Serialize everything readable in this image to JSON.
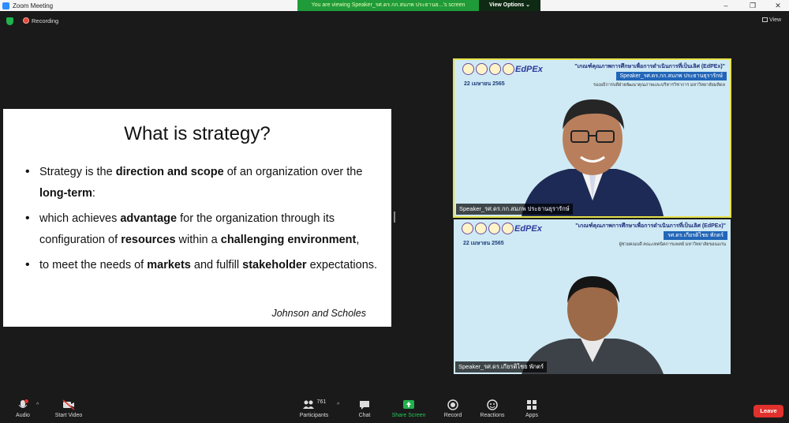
{
  "window": {
    "title": "Zoom Meeting",
    "minimize": "–",
    "restore": "❐",
    "close": "✕"
  },
  "share_banner": {
    "text": "You are viewing Speaker_รศ.ดร.กก.สมภพ ประธานธ...'s screen",
    "view_options": "View Options ⌄"
  },
  "topbar": {
    "recording_label": "Recording",
    "view_label": "View"
  },
  "slide": {
    "title": "What is strategy?",
    "bullets": [
      [
        "Strategy is the ",
        "direction and scope",
        " of an organization over the ",
        "long-term",
        ":"
      ],
      [
        "which achieves ",
        "advantage",
        " for the organization through its configuration of ",
        "resources",
        " within a ",
        "challenging environment",
        ","
      ],
      [
        "to meet the needs of ",
        "markets",
        " and fulfill ",
        "stakeholder",
        " expectations."
      ]
    ],
    "citation": "Johnson and Scholes"
  },
  "video_tiles": [
    {
      "brand": "EdPEx",
      "event": "\"เกณฑ์คุณภาพการศึกษาเพื่อการดำเนินการที่เป็นเลิศ (EdPEx)\"",
      "date": "22 เมษายน 2565",
      "speaker_line": "Speaker_รศ.ดร.กก.สมภพ ประธานธุรารักษ์",
      "role": "รองอธิการบดีฝ่ายพัฒนาคุณภาพและบริหารวิชาการ มหาวิทยาลัยมหิดล",
      "name_tag": "Speaker_รศ.ดร.กก.สมภพ ประธานธุรารักษ์",
      "active": true
    },
    {
      "brand": "EdPEx",
      "event": "\"เกณฑ์คุณภาพการศึกษาเพื่อการดำเนินการที่เป็นเลิศ (EdPEx)\"",
      "date": "22 เมษายน 2565",
      "speaker_line": "รศ.ดร.เกียรติไชย พักตร์",
      "role": "ผู้ช่วยคณบดี คณะเทคนิคการแพทย์ มหาวิทยาลัยขอนแก่น",
      "name_tag": "Speaker_รศ.ดร.เกียรติไชย พักตร์",
      "active": false
    }
  ],
  "toolbar": {
    "audio": "Audio",
    "audio_badge": "!",
    "video": "Start Video",
    "participants": "Participants",
    "participants_count": "761",
    "chat": "Chat",
    "share": "Share Screen",
    "record": "Record",
    "reactions": "Reactions",
    "apps": "Apps",
    "leave": "Leave"
  },
  "colors": {
    "share_green": "#1f9b3a",
    "leave_red": "#e0312c",
    "active_border": "#e5e14a"
  }
}
